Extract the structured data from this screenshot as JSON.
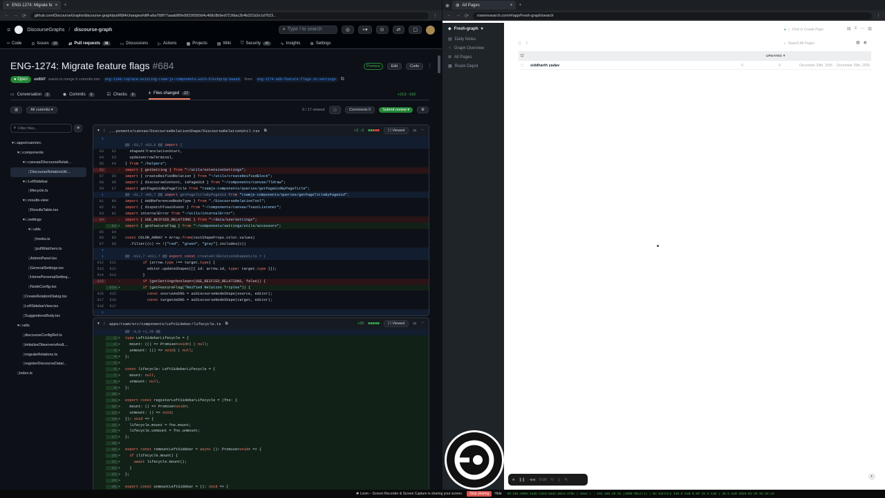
{
  "left_browser": {
    "tab_title": "ENG-1274: Migrate fe",
    "url": "github.com/DiscourseGraphs/discourse-graph/pull/684/changes#diff-a6a768f77aaab8f0e99226550d4c468c8b9ed721fdac2b4b321b2e1d7623...",
    "repo_owner": "DiscourseGraphs",
    "repo_name": "discourse-graph",
    "search_placeholder": "Type / to search",
    "nav": [
      {
        "label": "Code",
        "count": ""
      },
      {
        "label": "Issues",
        "count": "18"
      },
      {
        "label": "Pull requests",
        "count": "38"
      },
      {
        "label": "Discussions",
        "count": ""
      },
      {
        "label": "Actions",
        "count": ""
      },
      {
        "label": "Projects",
        "count": ""
      },
      {
        "label": "Wiki",
        "count": ""
      },
      {
        "label": "Security",
        "count": "40"
      },
      {
        "label": "Insights",
        "count": ""
      },
      {
        "label": "Settings",
        "count": ""
      }
    ],
    "pr_title": "ENG-1274: Migrate feature flags",
    "pr_number": "#684",
    "status": "Open",
    "author": "sid597",
    "merge_text": "wants to merge 6 commits into",
    "base_branch": "eng-1199-replace-existing-roam-js-components-with-blockprop-based",
    "from_text": "from",
    "head_branch": "eng-1274-add-feature-flags-in-settings",
    "preview_label": "Preview",
    "edit_label": "Edit",
    "code_label": "Code",
    "tabs": [
      {
        "label": "Conversation",
        "count": "3"
      },
      {
        "label": "Commits",
        "count": "6"
      },
      {
        "label": "Checks",
        "count": "6"
      },
      {
        "label": "Files changed",
        "count": "17"
      }
    ],
    "diffstat": "+213 −192",
    "all_commits": "All commits",
    "viewed_count": "0 / 17 viewed",
    "comments_label": "Comments",
    "comments_count": "0",
    "submit_review": "Submit review",
    "filter_placeholder": "Filter files...",
    "tree": [
      {
        "label": "apps/roam/src",
        "depth": 0,
        "type": "folder"
      },
      {
        "label": "components",
        "depth": 1,
        "type": "folder"
      },
      {
        "label": "canvas/DiscourseRelati...",
        "depth": 2,
        "type": "folder"
      },
      {
        "label": "DiscourseRelationUtil...",
        "depth": 3,
        "type": "file",
        "selected": true
      },
      {
        "label": "LeftSidebar",
        "depth": 2,
        "type": "folder"
      },
      {
        "label": "lifecycle.ts",
        "depth": 3,
        "type": "file"
      },
      {
        "label": "results-view",
        "depth": 2,
        "type": "folder"
      },
      {
        "label": "ResultsTable.tsx",
        "depth": 3,
        "type": "file"
      },
      {
        "label": "settings",
        "depth": 2,
        "type": "folder"
      },
      {
        "label": "utils",
        "depth": 3,
        "type": "folder"
      },
      {
        "label": "hooks.ts",
        "depth": 4,
        "type": "file"
      },
      {
        "label": "pullWatchers.ts",
        "depth": 4,
        "type": "file"
      },
      {
        "label": "AdminPanel.tsx",
        "depth": 3,
        "type": "file"
      },
      {
        "label": "GeneralSettings.tsx",
        "depth": 3,
        "type": "file"
      },
      {
        "label": "HomePersonalSetting...",
        "depth": 3,
        "type": "file"
      },
      {
        "label": "NodeConfig.tsx",
        "depth": 3,
        "type": "file"
      },
      {
        "label": "CreateRelationDialog.tsx",
        "depth": 2,
        "type": "file"
      },
      {
        "label": "LeftSidebarView.tsx",
        "depth": 2,
        "type": "file"
      },
      {
        "label": "SuggestionsBody.tsx",
        "depth": 2,
        "type": "file"
      },
      {
        "label": "utils",
        "depth": 1,
        "type": "folder"
      },
      {
        "label": "discourseConfigRef.ts",
        "depth": 2,
        "type": "file"
      },
      {
        "label": "initializeObserversAndL...",
        "depth": 2,
        "type": "file"
      },
      {
        "label": "migrateRelations.ts",
        "depth": 2,
        "type": "file"
      },
      {
        "label": "registerDiscourseDatal...",
        "depth": 2,
        "type": "file"
      },
      {
        "label": "index.ts",
        "depth": 1,
        "type": "file"
      }
    ],
    "file1": {
      "path": "...ponents/canvas/DiscourseRelationShape/DiscourseRelationUtil.tsx",
      "stat": "+2 −3",
      "viewed": "Viewed",
      "lines": [
        {
          "t": "exp",
          "o": "",
          "n": "",
          "c": ""
        },
        {
          "t": "hunk",
          "o": "",
          "n": "",
          "c": "@@ -63,7 +63,6 @@ import {"
        },
        {
          "t": "ctx",
          "o": "63",
          "n": "62",
          "c": "  shapeAtTranslationStart,"
        },
        {
          "t": "ctx",
          "o": "64",
          "n": "63",
          "c": "  updateArrowTerminal,"
        },
        {
          "t": "ctx",
          "o": "65",
          "n": "64",
          "c": "} from \"./helpers\";"
        },
        {
          "t": "del",
          "o": "66",
          "n": "",
          "c": "import { getSetting } from \"~/utils/extensionSettings\";"
        },
        {
          "t": "ctx",
          "o": "67",
          "n": "65",
          "c": "import { createReifiedRelation } from \"~/utils/createReifiedBlock\";"
        },
        {
          "t": "ctx",
          "o": "68",
          "n": "66",
          "c": "import { discourseContext, isPageUid } from \"~/components/canvas/Tldraw\";"
        },
        {
          "t": "ctx",
          "o": "69",
          "n": "67",
          "c": "import getPageUidByPageTitle from \"roamjs-components/queries/getPageUidByPageTitle\";"
        },
        {
          "t": "exp",
          "o": "",
          "n": "",
          "c": "@@ -81,7 +80,7 @@ import getPageTitleByPageUid from \"roamjs-components/queries/getPageTitleByPageUid\";"
        },
        {
          "t": "ctx",
          "o": "81",
          "n": "80",
          "c": "import { AddReferencedNodeType } from \"./DiscourseRelationTool\";"
        },
        {
          "t": "ctx",
          "o": "82",
          "n": "81",
          "c": "import { dispatchToastEvent } from \"~/components/canvas/ToastListener\";"
        },
        {
          "t": "ctx",
          "o": "83",
          "n": "82",
          "c": "import internalError from \"~/utils/internalError\";"
        },
        {
          "t": "del",
          "o": "84",
          "n": "",
          "c": "import { USE_REIFIED_RELATIONS } from \"~/data/userSettings\";"
        },
        {
          "t": "add",
          "o": "",
          "n": "83",
          "c": "import { getFeatureFlag } from \"~/components/settings/utils/accessors\";"
        },
        {
          "t": "ctx",
          "o": "85",
          "n": "84",
          "c": ""
        },
        {
          "t": "ctx",
          "o": "86",
          "n": "85",
          "c": "const COLOR_ARRAY = Array.from(textShapeProps.color.values)"
        },
        {
          "t": "ctx",
          "o": "87",
          "n": "86",
          "c": "  .filter((c) => ![\"red\", \"green\", \"grey\"].includes(c))"
        },
        {
          "t": "exp",
          "o": "",
          "n": "",
          "c": ""
        },
        {
          "t": "exp",
          "o": "",
          "n": "",
          "c": "@@ -612,7 +611,7 @@ export const createAllRelationShapeUtils = ("
        },
        {
          "t": "ctx",
          "o": "612",
          "n": "611",
          "c": "        if (arrow.type !== target.type) {"
        },
        {
          "t": "ctx",
          "o": "613",
          "n": "612",
          "c": "          editor.updateShapes([{ id: arrow.id, type: target.type }]);"
        },
        {
          "t": "ctx",
          "o": "614",
          "n": "613",
          "c": "        }"
        },
        {
          "t": "del",
          "o": "615",
          "n": "",
          "c": "        if (getSetting<boolean>(USE_REIFIED_RELATIONS, false)) {"
        },
        {
          "t": "add",
          "o": "",
          "n": "614",
          "c": "        if (getFeatureFlag(\"Reified Relation Triples\")) {"
        },
        {
          "t": "ctx",
          "o": "616",
          "n": "615",
          "c": "          const sourceAsDNS = asDiscourseNodeShape(source, editor);"
        },
        {
          "t": "ctx",
          "o": "617",
          "n": "616",
          "c": "          const targetAsDNS = asDiscourseNodeShape(target, editor);"
        },
        {
          "t": "ctx",
          "o": "618",
          "n": "617",
          "c": ""
        },
        {
          "t": "exp",
          "o": "",
          "n": "",
          "c": ""
        }
      ]
    },
    "file2": {
      "path": "apps/roam/src/components/LeftSidebar/lifecycle.ts",
      "stat": "+29",
      "viewed": "Viewed",
      "lines": [
        {
          "t": "hunk",
          "o": "",
          "n": "",
          "c": "@@ -0,0 +1,29 @@"
        },
        {
          "t": "add",
          "o": "",
          "n": "1",
          "c": "type LeftSidebarLifecycle = {"
        },
        {
          "t": "add",
          "o": "",
          "n": "2",
          "c": "  mount: (() => Promise<void>) | null;"
        },
        {
          "t": "add",
          "o": "",
          "n": "3",
          "c": "  unmount: (() => void) | null;"
        },
        {
          "t": "add",
          "o": "",
          "n": "4",
          "c": "};"
        },
        {
          "t": "add",
          "o": "",
          "n": "5",
          "c": ""
        },
        {
          "t": "add",
          "o": "",
          "n": "6",
          "c": "const lifecycle: LeftSidebarLifecycle = {"
        },
        {
          "t": "add",
          "o": "",
          "n": "7",
          "c": "  mount: null,"
        },
        {
          "t": "add",
          "o": "",
          "n": "8",
          "c": "  unmount: null,"
        },
        {
          "t": "add",
          "o": "",
          "n": "9",
          "c": "};"
        },
        {
          "t": "add",
          "o": "",
          "n": "10",
          "c": ""
        },
        {
          "t": "add",
          "o": "",
          "n": "11",
          "c": "export const registerLeftSidebarLifecycle = (fns: {"
        },
        {
          "t": "add",
          "o": "",
          "n": "12",
          "c": "  mount: () => Promise<void>;"
        },
        {
          "t": "add",
          "o": "",
          "n": "13",
          "c": "  unmount: () => void;"
        },
        {
          "t": "add",
          "o": "",
          "n": "14",
          "c": "}): void => {"
        },
        {
          "t": "add",
          "o": "",
          "n": "15",
          "c": "  lifecycle.mount = fns.mount;"
        },
        {
          "t": "add",
          "o": "",
          "n": "16",
          "c": "  lifecycle.unmount = fns.unmount;"
        },
        {
          "t": "add",
          "o": "",
          "n": "17",
          "c": "};"
        },
        {
          "t": "add",
          "o": "",
          "n": "18",
          "c": ""
        },
        {
          "t": "add",
          "o": "",
          "n": "19",
          "c": "export const remountLeftSidebar = async (): Promise<void> => {"
        },
        {
          "t": "add",
          "o": "",
          "n": "20",
          "c": "  if (lifecycle.mount) {"
        },
        {
          "t": "add",
          "o": "",
          "n": "21",
          "c": "    await lifecycle.mount();"
        },
        {
          "t": "add",
          "o": "",
          "n": "22",
          "c": "  }"
        },
        {
          "t": "add",
          "o": "",
          "n": "23",
          "c": "};"
        },
        {
          "t": "add",
          "o": "",
          "n": "24",
          "c": ""
        },
        {
          "t": "add",
          "o": "",
          "n": "25",
          "c": "export const unmountLeftSidebar = (): void => {"
        }
      ]
    }
  },
  "right_browser": {
    "tab_title": "All Pages",
    "url": "roamresearch.com/#/app/Fresh-graph/search",
    "graph_name": "Fresh-graph",
    "sidebar": [
      "Daily Notes",
      "Graph Overview",
      "All Pages",
      "Roam Depot"
    ],
    "find_placeholder": "Find or Create Page",
    "search_placeholder": "Search All Pages",
    "col_updated": "UPDATED",
    "row": {
      "title": "siddharth yadav",
      "words": "0",
      "refs": "0",
      "updated": "December 29th, 2025",
      "created": "December 29th, 2025"
    }
  },
  "screen_recorder": {
    "time": "0:00"
  },
  "taskbar": {
    "loom_msg": "Loom – Screen Recorder & Screen Capture is sharing your screen.",
    "stop_sharing": "Stop sharing",
    "hide": "Hide",
    "status_text": "05:201:5004:1a2b:c3e3:bdd4:a0ce:ef0b | down | : 192.168.29.31 (1000 Mbit/s) | No battery 139.0 GiB 0.89 15.3 GiB | 46.5 GiB 2026-01-29 02:15:16"
  }
}
